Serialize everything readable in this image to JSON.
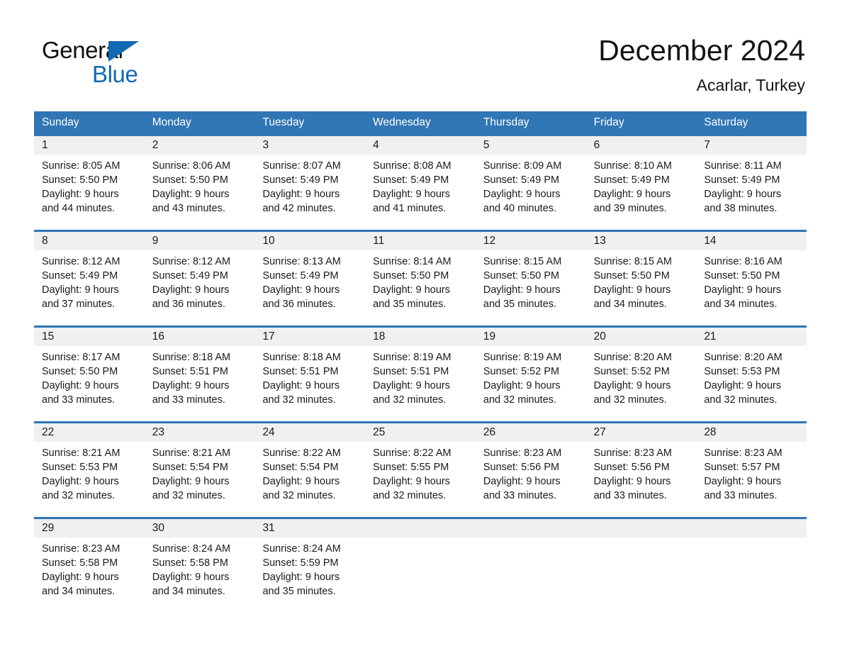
{
  "brand": {
    "name_top": "General",
    "name_bottom": "Blue",
    "triangle_color": "#1268b3"
  },
  "header": {
    "month_title": "December 2024",
    "location": "Acarlar, Turkey"
  },
  "colors": {
    "header_blue": "#3075b4",
    "row_divider_blue": "#3075b4",
    "day_band_gray": "#f0f0f0",
    "text": "#1a1a1a",
    "header_text": "#ffffff"
  },
  "weekdays": [
    "Sunday",
    "Monday",
    "Tuesday",
    "Wednesday",
    "Thursday",
    "Friday",
    "Saturday"
  ],
  "weeks": [
    {
      "days": [
        {
          "date": "1",
          "sunrise": "Sunrise: 8:05 AM",
          "sunset": "Sunset: 5:50 PM",
          "daylight_line1": "Daylight: 9 hours",
          "daylight_line2": "and 44 minutes."
        },
        {
          "date": "2",
          "sunrise": "Sunrise: 8:06 AM",
          "sunset": "Sunset: 5:50 PM",
          "daylight_line1": "Daylight: 9 hours",
          "daylight_line2": "and 43 minutes."
        },
        {
          "date": "3",
          "sunrise": "Sunrise: 8:07 AM",
          "sunset": "Sunset: 5:49 PM",
          "daylight_line1": "Daylight: 9 hours",
          "daylight_line2": "and 42 minutes."
        },
        {
          "date": "4",
          "sunrise": "Sunrise: 8:08 AM",
          "sunset": "Sunset: 5:49 PM",
          "daylight_line1": "Daylight: 9 hours",
          "daylight_line2": "and 41 minutes."
        },
        {
          "date": "5",
          "sunrise": "Sunrise: 8:09 AM",
          "sunset": "Sunset: 5:49 PM",
          "daylight_line1": "Daylight: 9 hours",
          "daylight_line2": "and 40 minutes."
        },
        {
          "date": "6",
          "sunrise": "Sunrise: 8:10 AM",
          "sunset": "Sunset: 5:49 PM",
          "daylight_line1": "Daylight: 9 hours",
          "daylight_line2": "and 39 minutes."
        },
        {
          "date": "7",
          "sunrise": "Sunrise: 8:11 AM",
          "sunset": "Sunset: 5:49 PM",
          "daylight_line1": "Daylight: 9 hours",
          "daylight_line2": "and 38 minutes."
        }
      ]
    },
    {
      "days": [
        {
          "date": "8",
          "sunrise": "Sunrise: 8:12 AM",
          "sunset": "Sunset: 5:49 PM",
          "daylight_line1": "Daylight: 9 hours",
          "daylight_line2": "and 37 minutes."
        },
        {
          "date": "9",
          "sunrise": "Sunrise: 8:12 AM",
          "sunset": "Sunset: 5:49 PM",
          "daylight_line1": "Daylight: 9 hours",
          "daylight_line2": "and 36 minutes."
        },
        {
          "date": "10",
          "sunrise": "Sunrise: 8:13 AM",
          "sunset": "Sunset: 5:49 PM",
          "daylight_line1": "Daylight: 9 hours",
          "daylight_line2": "and 36 minutes."
        },
        {
          "date": "11",
          "sunrise": "Sunrise: 8:14 AM",
          "sunset": "Sunset: 5:50 PM",
          "daylight_line1": "Daylight: 9 hours",
          "daylight_line2": "and 35 minutes."
        },
        {
          "date": "12",
          "sunrise": "Sunrise: 8:15 AM",
          "sunset": "Sunset: 5:50 PM",
          "daylight_line1": "Daylight: 9 hours",
          "daylight_line2": "and 35 minutes."
        },
        {
          "date": "13",
          "sunrise": "Sunrise: 8:15 AM",
          "sunset": "Sunset: 5:50 PM",
          "daylight_line1": "Daylight: 9 hours",
          "daylight_line2": "and 34 minutes."
        },
        {
          "date": "14",
          "sunrise": "Sunrise: 8:16 AM",
          "sunset": "Sunset: 5:50 PM",
          "daylight_line1": "Daylight: 9 hours",
          "daylight_line2": "and 34 minutes."
        }
      ]
    },
    {
      "days": [
        {
          "date": "15",
          "sunrise": "Sunrise: 8:17 AM",
          "sunset": "Sunset: 5:50 PM",
          "daylight_line1": "Daylight: 9 hours",
          "daylight_line2": "and 33 minutes."
        },
        {
          "date": "16",
          "sunrise": "Sunrise: 8:18 AM",
          "sunset": "Sunset: 5:51 PM",
          "daylight_line1": "Daylight: 9 hours",
          "daylight_line2": "and 33 minutes."
        },
        {
          "date": "17",
          "sunrise": "Sunrise: 8:18 AM",
          "sunset": "Sunset: 5:51 PM",
          "daylight_line1": "Daylight: 9 hours",
          "daylight_line2": "and 32 minutes."
        },
        {
          "date": "18",
          "sunrise": "Sunrise: 8:19 AM",
          "sunset": "Sunset: 5:51 PM",
          "daylight_line1": "Daylight: 9 hours",
          "daylight_line2": "and 32 minutes."
        },
        {
          "date": "19",
          "sunrise": "Sunrise: 8:19 AM",
          "sunset": "Sunset: 5:52 PM",
          "daylight_line1": "Daylight: 9 hours",
          "daylight_line2": "and 32 minutes."
        },
        {
          "date": "20",
          "sunrise": "Sunrise: 8:20 AM",
          "sunset": "Sunset: 5:52 PM",
          "daylight_line1": "Daylight: 9 hours",
          "daylight_line2": "and 32 minutes."
        },
        {
          "date": "21",
          "sunrise": "Sunrise: 8:20 AM",
          "sunset": "Sunset: 5:53 PM",
          "daylight_line1": "Daylight: 9 hours",
          "daylight_line2": "and 32 minutes."
        }
      ]
    },
    {
      "days": [
        {
          "date": "22",
          "sunrise": "Sunrise: 8:21 AM",
          "sunset": "Sunset: 5:53 PM",
          "daylight_line1": "Daylight: 9 hours",
          "daylight_line2": "and 32 minutes."
        },
        {
          "date": "23",
          "sunrise": "Sunrise: 8:21 AM",
          "sunset": "Sunset: 5:54 PM",
          "daylight_line1": "Daylight: 9 hours",
          "daylight_line2": "and 32 minutes."
        },
        {
          "date": "24",
          "sunrise": "Sunrise: 8:22 AM",
          "sunset": "Sunset: 5:54 PM",
          "daylight_line1": "Daylight: 9 hours",
          "daylight_line2": "and 32 minutes."
        },
        {
          "date": "25",
          "sunrise": "Sunrise: 8:22 AM",
          "sunset": "Sunset: 5:55 PM",
          "daylight_line1": "Daylight: 9 hours",
          "daylight_line2": "and 32 minutes."
        },
        {
          "date": "26",
          "sunrise": "Sunrise: 8:23 AM",
          "sunset": "Sunset: 5:56 PM",
          "daylight_line1": "Daylight: 9 hours",
          "daylight_line2": "and 33 minutes."
        },
        {
          "date": "27",
          "sunrise": "Sunrise: 8:23 AM",
          "sunset": "Sunset: 5:56 PM",
          "daylight_line1": "Daylight: 9 hours",
          "daylight_line2": "and 33 minutes."
        },
        {
          "date": "28",
          "sunrise": "Sunrise: 8:23 AM",
          "sunset": "Sunset: 5:57 PM",
          "daylight_line1": "Daylight: 9 hours",
          "daylight_line2": "and 33 minutes."
        }
      ]
    },
    {
      "days": [
        {
          "date": "29",
          "sunrise": "Sunrise: 8:23 AM",
          "sunset": "Sunset: 5:58 PM",
          "daylight_line1": "Daylight: 9 hours",
          "daylight_line2": "and 34 minutes."
        },
        {
          "date": "30",
          "sunrise": "Sunrise: 8:24 AM",
          "sunset": "Sunset: 5:58 PM",
          "daylight_line1": "Daylight: 9 hours",
          "daylight_line2": "and 34 minutes."
        },
        {
          "date": "31",
          "sunrise": "Sunrise: 8:24 AM",
          "sunset": "Sunset: 5:59 PM",
          "daylight_line1": "Daylight: 9 hours",
          "daylight_line2": "and 35 minutes."
        },
        {
          "date": "",
          "sunrise": "",
          "sunset": "",
          "daylight_line1": "",
          "daylight_line2": ""
        },
        {
          "date": "",
          "sunrise": "",
          "sunset": "",
          "daylight_line1": "",
          "daylight_line2": ""
        },
        {
          "date": "",
          "sunrise": "",
          "sunset": "",
          "daylight_line1": "",
          "daylight_line2": ""
        },
        {
          "date": "",
          "sunrise": "",
          "sunset": "",
          "daylight_line1": "",
          "daylight_line2": ""
        }
      ]
    }
  ]
}
